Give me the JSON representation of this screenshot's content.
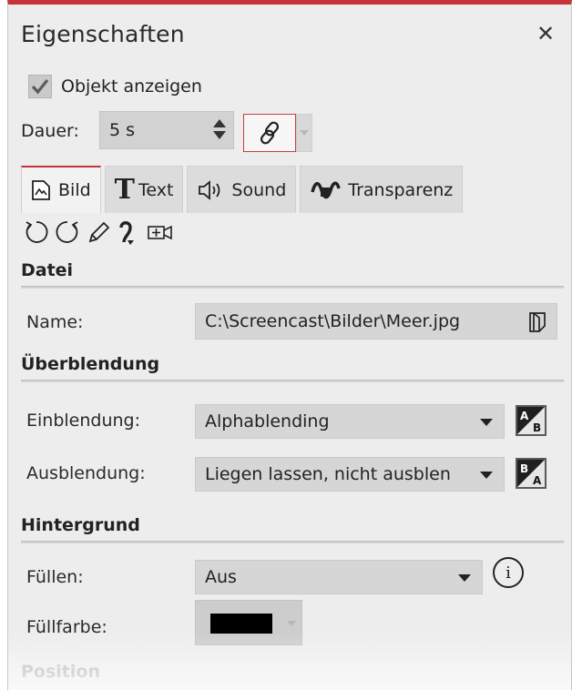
{
  "panel": {
    "title": "Eigenschaften",
    "close_label": "✕",
    "accent": "#c4343a"
  },
  "show_object": {
    "label": "Objekt anzeigen",
    "checked": true
  },
  "duration": {
    "label": "Dauer:",
    "value": "5 s"
  },
  "tabs": [
    {
      "label": "Bild",
      "icon": "image-icon",
      "active": true
    },
    {
      "label": "Text",
      "icon": "text-T-icon",
      "active": false
    },
    {
      "label": "Sound",
      "icon": "speaker-icon",
      "active": false
    },
    {
      "label": "Transparenz",
      "icon": "transparency-icon",
      "active": false
    }
  ],
  "toolbar_icons": [
    "rotate-left-icon",
    "rotate-right-icon",
    "pencil-icon",
    "curve-arrow-icon",
    "camera-add-icon"
  ],
  "datei": {
    "title": "Datei",
    "name_label": "Name:",
    "name_value": "C:\\Screencast\\Bilder\\Meer.jpg"
  },
  "ueberblendung": {
    "title": "Überblendung",
    "in_label": "Einblendung:",
    "in_value": "Alphablending",
    "out_label": "Ausblendung:",
    "out_value": "Liegen lassen, nicht ausblen"
  },
  "hintergrund": {
    "title": "Hintergrund",
    "fill_label": "Füllen:",
    "fill_value": "Aus",
    "info_label": "i",
    "color_label": "Füllfarbe:",
    "color_value": "#000000"
  },
  "position": {
    "title": "Position"
  }
}
